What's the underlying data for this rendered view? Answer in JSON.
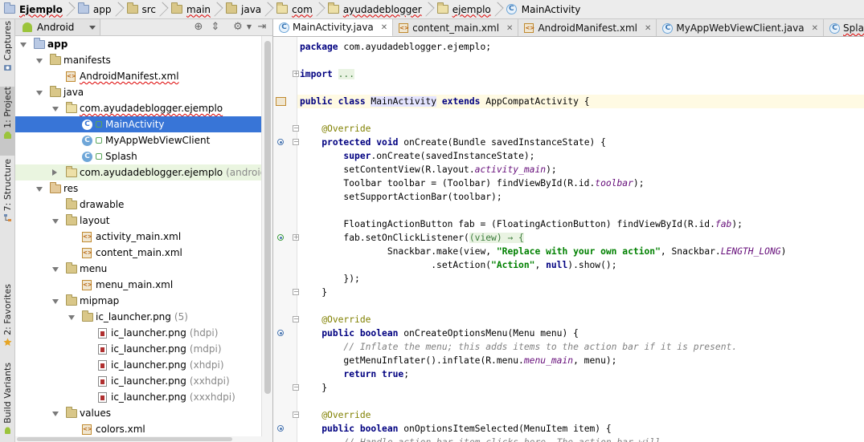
{
  "breadcrumb": [
    {
      "label": "Ejemplo",
      "icon": "module-folder-icon"
    },
    {
      "label": "app",
      "icon": "module-folder-icon"
    },
    {
      "label": "src",
      "icon": "folder-icon"
    },
    {
      "label": "main",
      "icon": "folder-icon"
    },
    {
      "label": "java",
      "icon": "folder-icon"
    },
    {
      "label": "com",
      "icon": "package-icon"
    },
    {
      "label": "ayudadeblogger",
      "icon": "package-icon"
    },
    {
      "label": "ejemplo",
      "icon": "package-icon"
    },
    {
      "label": "MainActivity",
      "icon": "class-icon"
    }
  ],
  "tool_stripe": {
    "captures": "Captures",
    "project": "1: Project",
    "structure": "7: Structure",
    "favorites": "2: Favorites",
    "build_variants": "Build Variants"
  },
  "project_panel": {
    "view_selector": "Android",
    "tree": [
      {
        "label": "app",
        "bold": true,
        "depth": 0,
        "expanded": true,
        "icon": "module-folder-icon"
      },
      {
        "label": "manifests",
        "depth": 1,
        "expanded": true,
        "icon": "folder-icon"
      },
      {
        "label": "AndroidManifest.xml",
        "depth": 2,
        "icon": "xml-file-icon",
        "wavy": true
      },
      {
        "label": "java",
        "depth": 1,
        "expanded": true,
        "icon": "folder-icon"
      },
      {
        "label": "com.ayudadeblogger.ejemplo",
        "depth": 2,
        "expanded": true,
        "icon": "package-icon",
        "wavy": true
      },
      {
        "label": "MainActivity",
        "depth": 3,
        "icon": "class-icon",
        "selected": true
      },
      {
        "label": "MyAppWebViewClient",
        "depth": 3,
        "icon": "class-icon"
      },
      {
        "label": "Splash",
        "depth": 3,
        "icon": "class-icon"
      },
      {
        "label": "com.ayudadeblogger.ejemplo",
        "suffix": "(androidTest)",
        "depth": 2,
        "expanded": false,
        "icon": "package-icon",
        "highlight": true
      },
      {
        "label": "res",
        "depth": 1,
        "expanded": true,
        "icon": "res-folder-icon"
      },
      {
        "label": "drawable",
        "depth": 2,
        "icon": "folder-icon"
      },
      {
        "label": "layout",
        "depth": 2,
        "expanded": true,
        "icon": "folder-icon"
      },
      {
        "label": "activity_main.xml",
        "depth": 3,
        "icon": "xml-file-icon"
      },
      {
        "label": "content_main.xml",
        "depth": 3,
        "icon": "xml-file-icon"
      },
      {
        "label": "menu",
        "depth": 2,
        "expanded": true,
        "icon": "folder-icon"
      },
      {
        "label": "menu_main.xml",
        "depth": 3,
        "icon": "xml-file-icon"
      },
      {
        "label": "mipmap",
        "depth": 2,
        "expanded": true,
        "icon": "folder-icon"
      },
      {
        "label": "ic_launcher.png",
        "suffix": "(5)",
        "depth": 3,
        "expanded": true,
        "icon": "folder-icon"
      },
      {
        "label": "ic_launcher.png",
        "suffix": "(hdpi)",
        "depth": 4,
        "icon": "png-file-icon"
      },
      {
        "label": "ic_launcher.png",
        "suffix": "(mdpi)",
        "depth": 4,
        "icon": "png-file-icon"
      },
      {
        "label": "ic_launcher.png",
        "suffix": "(xhdpi)",
        "depth": 4,
        "icon": "png-file-icon"
      },
      {
        "label": "ic_launcher.png",
        "suffix": "(xxhdpi)",
        "depth": 4,
        "icon": "png-file-icon"
      },
      {
        "label": "ic_launcher.png",
        "suffix": "(xxxhdpi)",
        "depth": 4,
        "icon": "png-file-icon"
      },
      {
        "label": "values",
        "depth": 2,
        "expanded": true,
        "icon": "folder-icon"
      },
      {
        "label": "colors.xml",
        "depth": 3,
        "icon": "xml-file-icon"
      }
    ]
  },
  "editor_tabs": [
    {
      "label": "MainActivity.java",
      "icon": "class-icon",
      "active": true
    },
    {
      "label": "content_main.xml",
      "icon": "xml-file-icon"
    },
    {
      "label": "AndroidManifest.xml",
      "icon": "xml-file-icon"
    },
    {
      "label": "MyAppWebViewClient.java",
      "icon": "class-icon"
    },
    {
      "label": "Splash.java",
      "icon": "class-icon"
    }
  ],
  "code_lines": [
    [
      {
        "t": "package ",
        "c": "kw"
      },
      {
        "t": "com.ayudadeblogger.ejemplo;"
      }
    ],
    [],
    [
      {
        "t": "import ",
        "c": "kw"
      },
      {
        "t": "...",
        "c": "fold"
      }
    ],
    [],
    [
      {
        "t": "public class ",
        "c": "kw"
      },
      {
        "t": "MainActivity",
        "c": "clsref"
      },
      {
        "t": " "
      },
      {
        "t": "extends ",
        "c": "kw"
      },
      {
        "t": "AppCompatActivity {"
      }
    ],
    [],
    [
      {
        "t": "    "
      },
      {
        "t": "@Override",
        "c": "an"
      }
    ],
    [
      {
        "t": "    "
      },
      {
        "t": "protected void ",
        "c": "kw"
      },
      {
        "t": "onCreate(Bundle savedInstanceState) {"
      }
    ],
    [
      {
        "t": "        "
      },
      {
        "t": "super",
        "c": "kw"
      },
      {
        "t": ".onCreate(savedInstanceState);"
      }
    ],
    [
      {
        "t": "        setContentView(R.layout."
      },
      {
        "t": "activity_main",
        "c": "fld"
      },
      {
        "t": ");"
      }
    ],
    [
      {
        "t": "        Toolbar toolbar = (Toolbar) findViewById(R.id."
      },
      {
        "t": "toolbar",
        "c": "fld"
      },
      {
        "t": ");"
      }
    ],
    [
      {
        "t": "        setSupportActionBar(toolbar);"
      }
    ],
    [],
    [
      {
        "t": "        FloatingActionButton fab = (FloatingActionButton) findViewById(R.id."
      },
      {
        "t": "fab",
        "c": "fld"
      },
      {
        "t": ");"
      }
    ],
    [
      {
        "t": "        fab.setOnClickListener("
      },
      {
        "t": "(view) → {",
        "c": "fold"
      }
    ],
    [
      {
        "t": "                Snackbar.make(view, "
      },
      {
        "t": "\"Replace with your own action\"",
        "c": "str"
      },
      {
        "t": ", Snackbar."
      },
      {
        "t": "LENGTH_LONG",
        "c": "fld"
      },
      {
        "t": ")"
      }
    ],
    [
      {
        "t": "                        .setAction("
      },
      {
        "t": "\"Action\"",
        "c": "str"
      },
      {
        "t": ", "
      },
      {
        "t": "null",
        "c": "kw"
      },
      {
        "t": ").show();"
      }
    ],
    [
      {
        "t": "        });"
      }
    ],
    [
      {
        "t": "    }"
      }
    ],
    [],
    [
      {
        "t": "    "
      },
      {
        "t": "@Override",
        "c": "an"
      }
    ],
    [
      {
        "t": "    "
      },
      {
        "t": "public boolean ",
        "c": "kw"
      },
      {
        "t": "onCreateOptionsMenu(Menu menu) {"
      }
    ],
    [
      {
        "t": "        "
      },
      {
        "t": "// Inflate the menu; this adds items to the action bar if it is present.",
        "c": "cm"
      }
    ],
    [
      {
        "t": "        getMenuInflater().inflate(R.menu."
      },
      {
        "t": "menu_main",
        "c": "fld"
      },
      {
        "t": ", menu);"
      }
    ],
    [
      {
        "t": "        "
      },
      {
        "t": "return true",
        "c": "kw"
      },
      {
        "t": ";"
      }
    ],
    [
      {
        "t": "    }"
      }
    ],
    [],
    [
      {
        "t": "    "
      },
      {
        "t": "@Override",
        "c": "an"
      }
    ],
    [
      {
        "t": "    "
      },
      {
        "t": "public boolean ",
        "c": "kw"
      },
      {
        "t": "onOptionsItemSelected(MenuItem item) {"
      }
    ],
    [
      {
        "t": "        "
      },
      {
        "t": "// Handle action bar item clicks here. The action bar will",
        "c": "cm"
      }
    ]
  ]
}
